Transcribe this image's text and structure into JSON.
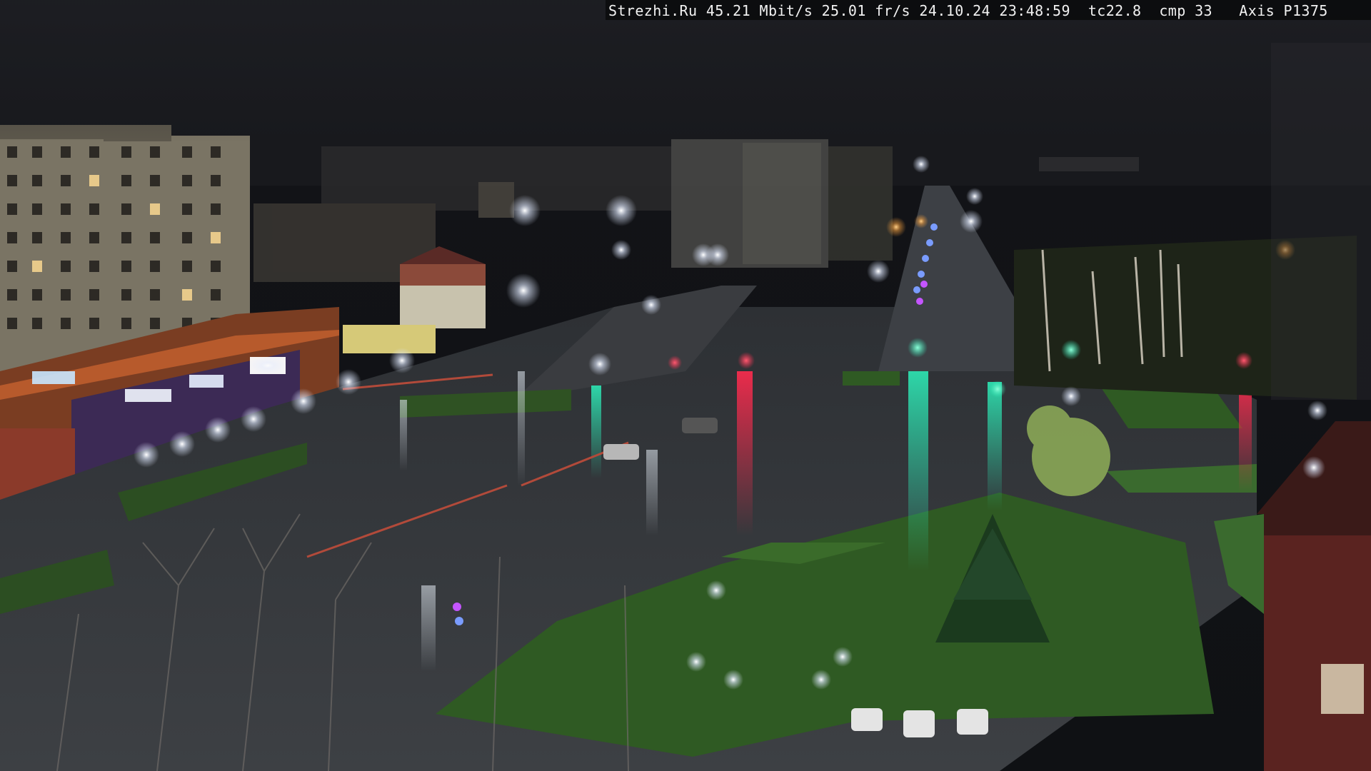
{
  "overlay": {
    "osd_text": "Strezhi.Ru 45.21 Mbit/s 25.01 fr/s 24.10.24 23:48:59  tc22.8  cmp 33   Axis P1375"
  },
  "scene": {
    "description_colors": {
      "sky": "#17181c",
      "wet_asphalt": "#3a3d42",
      "grass": "#2f5a23",
      "building_facade": "#8c8470",
      "shopping_center": "#8a4a2e",
      "red_reflection": "#ff2b4e",
      "green_reflection": "#2de8b5",
      "street_light": "#eaf2ff",
      "sodium_light": "#ffb347",
      "storefront_purple": "#6a3a9c"
    }
  }
}
